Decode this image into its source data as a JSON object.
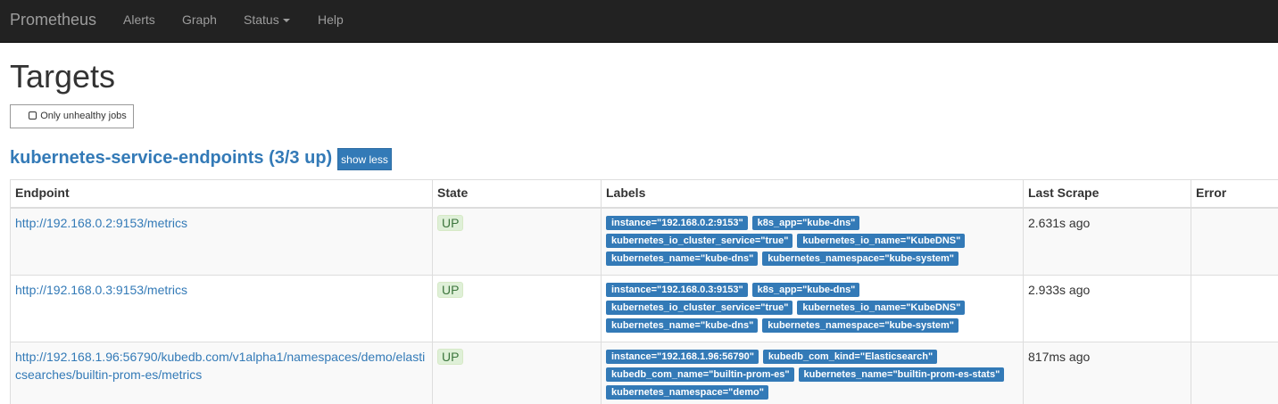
{
  "navbar": {
    "brand": "Prometheus",
    "items": [
      {
        "label": "Alerts"
      },
      {
        "label": "Graph"
      },
      {
        "label": "Status"
      },
      {
        "label": "Help"
      }
    ]
  },
  "page": {
    "title": "Targets",
    "filter_button": "Only unhealthy jobs"
  },
  "job": {
    "title": "kubernetes-service-endpoints (3/3 up)",
    "toggle_label": "show less"
  },
  "table": {
    "headers": [
      "Endpoint",
      "State",
      "Labels",
      "Last Scrape",
      "Error"
    ],
    "rows": [
      {
        "endpoint": "http://192.168.0.2:9153/metrics",
        "state": "UP",
        "labels": [
          "instance=\"192.168.0.2:9153\"",
          "k8s_app=\"kube-dns\"",
          "kubernetes_io_cluster_service=\"true\"",
          "kubernetes_io_name=\"KubeDNS\"",
          "kubernetes_name=\"kube-dns\"",
          "kubernetes_namespace=\"kube-system\""
        ],
        "last_scrape": "2.631s ago",
        "error": ""
      },
      {
        "endpoint": "http://192.168.0.3:9153/metrics",
        "state": "UP",
        "labels": [
          "instance=\"192.168.0.3:9153\"",
          "k8s_app=\"kube-dns\"",
          "kubernetes_io_cluster_service=\"true\"",
          "kubernetes_io_name=\"KubeDNS\"",
          "kubernetes_name=\"kube-dns\"",
          "kubernetes_namespace=\"kube-system\""
        ],
        "last_scrape": "2.933s ago",
        "error": ""
      },
      {
        "endpoint": "http://192.168.1.96:56790/kubedb.com/v1alpha1/namespaces/demo/elasticsearches/builtin-prom-es/metrics",
        "state": "UP",
        "labels": [
          "instance=\"192.168.1.96:56790\"",
          "kubedb_com_kind=\"Elasticsearch\"",
          "kubedb_com_name=\"builtin-prom-es\"",
          "kubernetes_name=\"builtin-prom-es-stats\"",
          "kubernetes_namespace=\"demo\""
        ],
        "last_scrape": "817ms ago",
        "error": ""
      }
    ]
  }
}
